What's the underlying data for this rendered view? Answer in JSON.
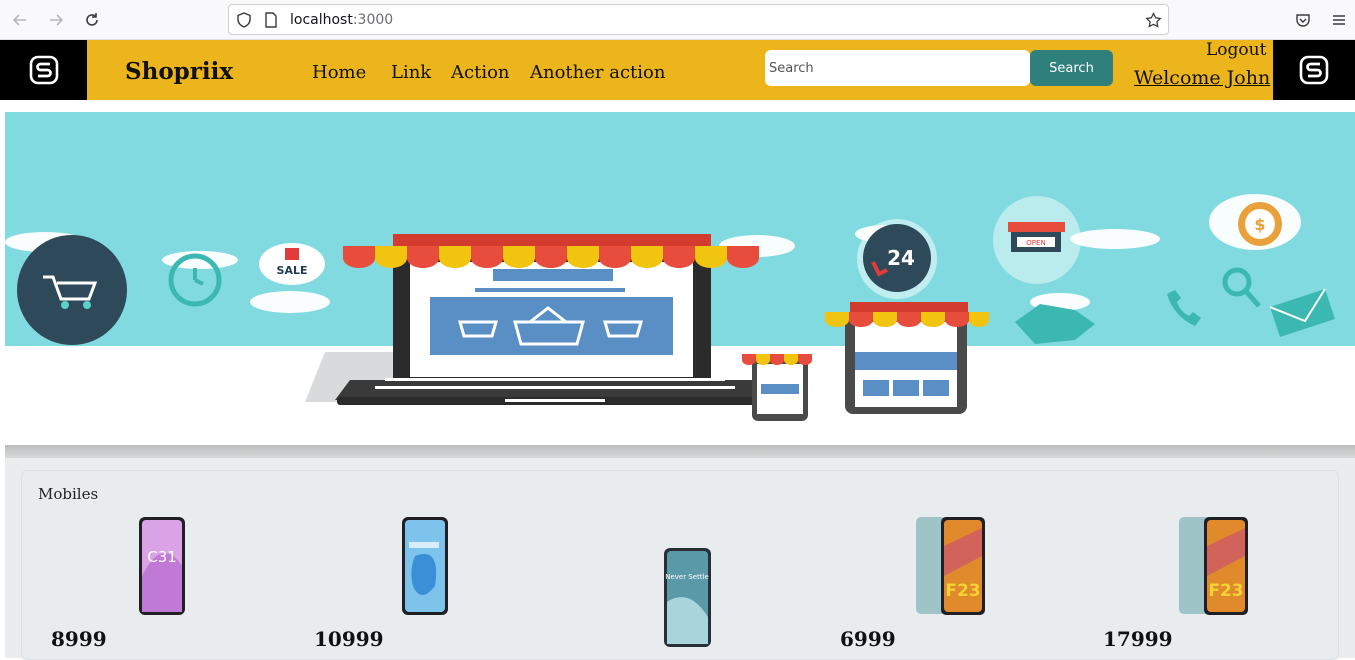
{
  "browser": {
    "url_host": "localhost",
    "url_port": ":3000"
  },
  "navbar": {
    "brand": "Shopriix",
    "links": [
      "Home",
      "Link",
      "Action",
      "Another action"
    ],
    "search_placeholder": "Search",
    "search_button": "Search",
    "logout": "Logout",
    "welcome": "Welcome John"
  },
  "hero": {
    "sale_badge": "SALE",
    "open_sign": "OPEN",
    "hours_badge": "24"
  },
  "products": {
    "category": "Mobiles",
    "items": [
      {
        "price": "8999",
        "phone_text": "C31"
      },
      {
        "price": "10999",
        "phone_text": ""
      },
      {
        "price": "",
        "phone_text": "Never Settle"
      },
      {
        "price": "6999",
        "phone_text": "F23"
      },
      {
        "price": "17999",
        "phone_text": "F23"
      }
    ]
  },
  "colors": {
    "navbar_bg": "#ecb51c",
    "search_btn": "#2f7f7d",
    "hero_sky": "#81dadf"
  }
}
